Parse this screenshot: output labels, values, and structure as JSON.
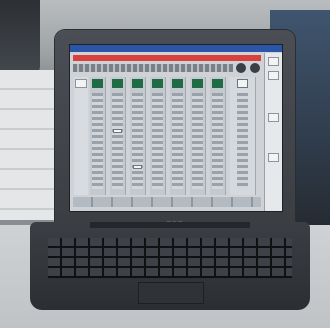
{
  "scene": {
    "description_hidden": "",
    "channels": 8
  },
  "colors": {
    "title_bar": "#2b55a6",
    "alert_bar": "#d8413c",
    "channel_indicator": "#1f6b44"
  }
}
